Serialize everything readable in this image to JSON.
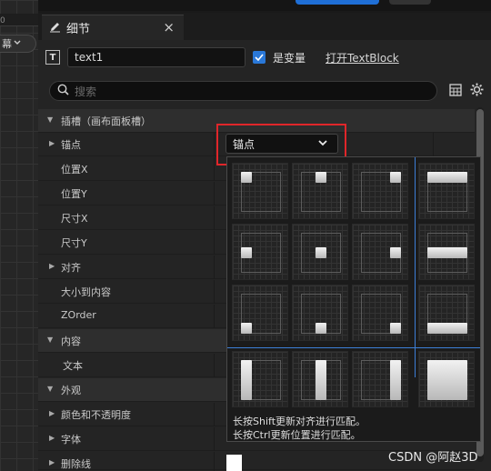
{
  "viewport": {
    "ruler_number": "0",
    "screen_dropdown_label": "幕"
  },
  "tab": {
    "label": "细节",
    "close": "×"
  },
  "header": {
    "widget_type_icon": "T",
    "name_value": "text1",
    "is_variable_label": "是变量",
    "is_variable_checked": true,
    "open_link": "打开TextBlock"
  },
  "search": {
    "placeholder": "搜索"
  },
  "rows": [
    {
      "label": "插槽（画布面板槽）",
      "category": true,
      "expanded": true
    },
    {
      "label": "锚点",
      "collapsed": true
    },
    {
      "label": "位置X"
    },
    {
      "label": "位置Y"
    },
    {
      "label": "尺寸X"
    },
    {
      "label": "尺寸Y"
    },
    {
      "label": "对齐",
      "collapsed": true
    },
    {
      "label": "大小到内容"
    },
    {
      "label": "ZOrder"
    },
    {
      "label": "内容",
      "category": true,
      "expanded": true
    },
    {
      "label": "文本"
    },
    {
      "label": "外观",
      "category": true,
      "expanded": true
    },
    {
      "label": "颜色和不透明度",
      "collapsed": true
    },
    {
      "label": "字体",
      "collapsed": true
    },
    {
      "label": "删除线",
      "collapsed": true
    }
  ],
  "anchor": {
    "dropdown_label": "锚点",
    "hint_shift": "长按Shift更新对齐进行匹配。",
    "hint_ctrl": "长按Ctrl更新位置进行匹配。",
    "presets": [
      "top-left",
      "top-center",
      "top-right",
      "top-stretch",
      "center-left",
      "center",
      "center-right",
      "center-stretch",
      "bottom-left",
      "bottom-center",
      "bottom-right",
      "bottom-stretch",
      "left-stretch",
      "center-vertical-stretch",
      "right-stretch",
      "fill"
    ]
  },
  "watermark": "CSDN @阿赵3D",
  "colors": {
    "accent": "#2a78d8",
    "highlight_box": "#e0262a",
    "guide_line": "#3c7fd8"
  }
}
